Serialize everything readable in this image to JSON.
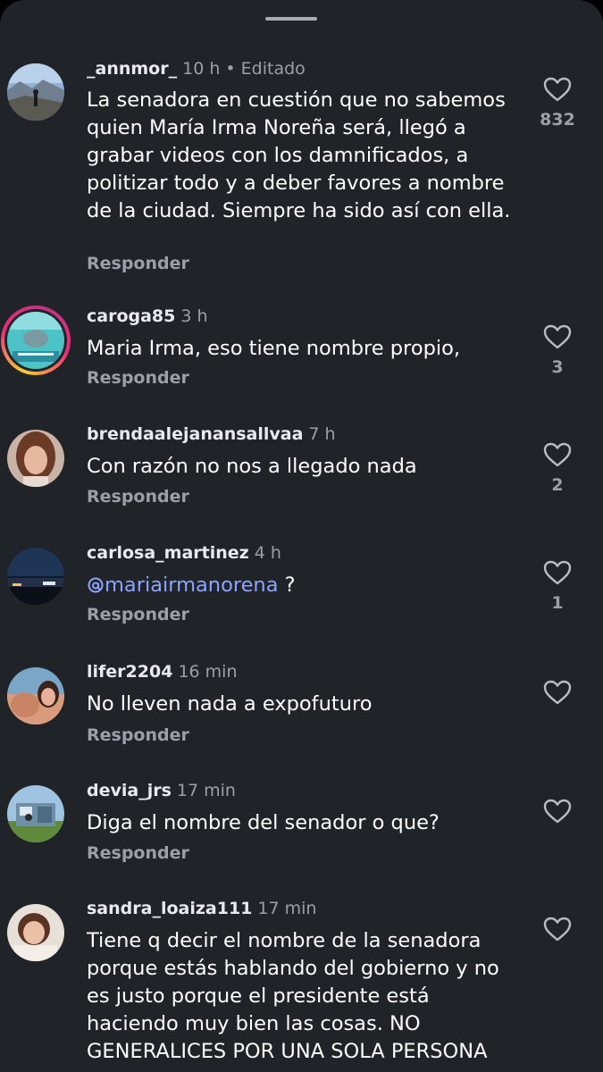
{
  "sheet": {
    "handle": "drag-handle"
  },
  "reply_label": "Responder",
  "comments": [
    {
      "username": "_annmor_",
      "time": "10 h",
      "edited": " • Editado",
      "text": "La senadora en cuestión que no sabemos quien María Irma Noreña será, llegó a grabar videos con los damnificados, a politizar todo y a deber favores a nombre de la ciudad. Siempre ha sido así con ella.",
      "likes": "832"
    },
    {
      "username": "caroga85",
      "time": "3 h",
      "text": "Maria Irma, eso tiene nombre propio,",
      "likes": "3"
    },
    {
      "username": "brendaalejanansallvaa",
      "time": "7 h",
      "text": "Con razón no nos a llegado nada",
      "likes": "2"
    },
    {
      "username": "carlosa_martinez",
      "time": "4 h",
      "mention": "mariairmanorena",
      "text_after": " ?",
      "likes": "1"
    },
    {
      "username": "lifer2204",
      "time": "16 min",
      "text": "No lleven nada a expofuturo"
    },
    {
      "username": "devia_jrs",
      "time": "17 min",
      "text": "Diga el nombre del senador o que?"
    },
    {
      "username": "sandra_loaiza111",
      "time": "17 min",
      "text": "Tiene q decir el nombre de la senadora porque estás hablando del gobierno y no es justo porque el presidente está haciendo muy bien las cosas. NO GENERALICES POR UNA SOLA PERSONA"
    }
  ],
  "icons": {
    "like": "heart-outline-icon",
    "mention": "threads-at-icon"
  },
  "colors": {
    "background": "#202327",
    "text": "#ffffff",
    "secondary": "#9aa0a6",
    "mention": "#8aa4ff"
  }
}
